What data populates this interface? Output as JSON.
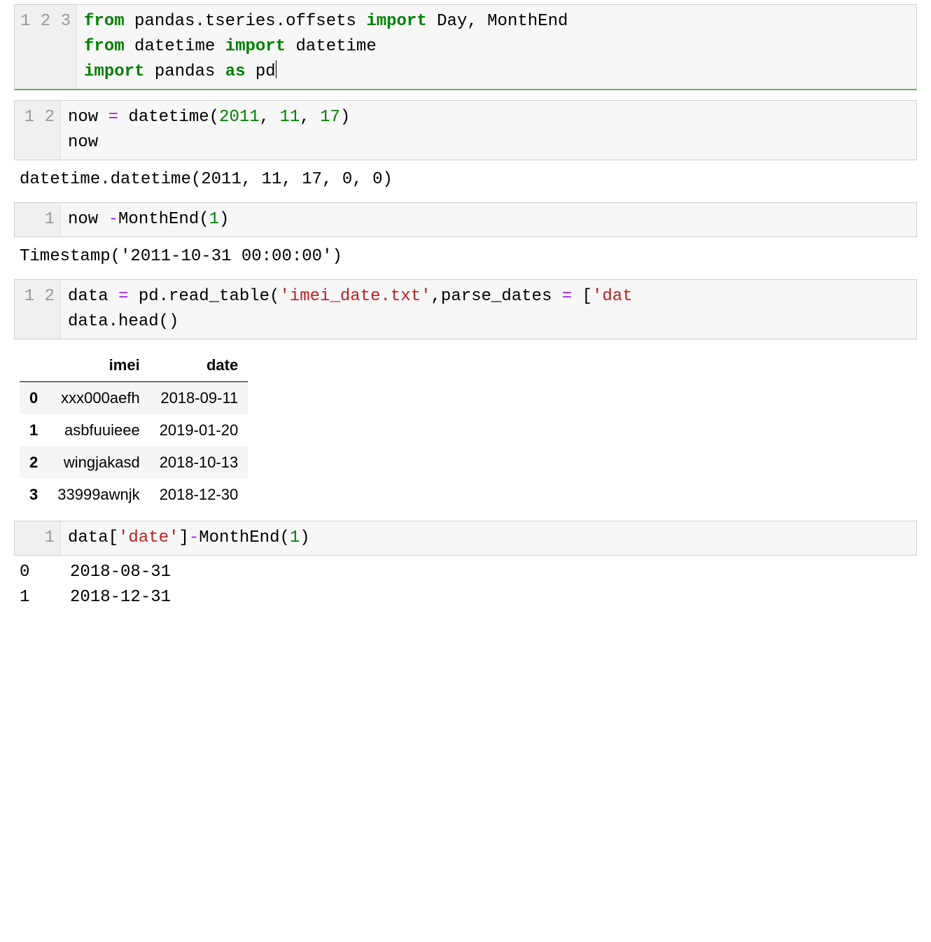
{
  "cells": [
    {
      "lines": [
        "1",
        "2",
        "3"
      ],
      "tokens": [
        [
          [
            "from",
            "kw"
          ],
          [
            " ",
            "id"
          ],
          [
            "pandas.tseries.offsets",
            "id"
          ],
          [
            " ",
            "id"
          ],
          [
            "import",
            "kw"
          ],
          [
            " ",
            "id"
          ],
          [
            "Day, MonthEnd",
            "id"
          ]
        ],
        [
          [
            "from",
            "kw"
          ],
          [
            " ",
            "id"
          ],
          [
            "datetime",
            "id"
          ],
          [
            " ",
            "id"
          ],
          [
            "import",
            "kw"
          ],
          [
            " ",
            "id"
          ],
          [
            "datetime",
            "id"
          ]
        ],
        [
          [
            "import",
            "kw"
          ],
          [
            " ",
            "id"
          ],
          [
            "pandas",
            "id"
          ],
          [
            " ",
            "id"
          ],
          [
            "as",
            "kw"
          ],
          [
            " ",
            "id"
          ],
          [
            "pd",
            "id"
          ]
        ]
      ],
      "ran_ok": true,
      "cursor_end": true
    },
    {
      "lines": [
        "1",
        "2"
      ],
      "tokens": [
        [
          [
            "now ",
            "id"
          ],
          [
            "=",
            "op"
          ],
          [
            " datetime(",
            "id"
          ],
          [
            "2011",
            "num"
          ],
          [
            ", ",
            "id"
          ],
          [
            "11",
            "num"
          ],
          [
            ", ",
            "id"
          ],
          [
            "17",
            "num"
          ],
          [
            ")",
            "id"
          ]
        ],
        [
          [
            "now",
            "id"
          ]
        ]
      ],
      "output": "datetime.datetime(2011, 11, 17, 0, 0)"
    },
    {
      "lines": [
        "1"
      ],
      "tokens": [
        [
          [
            "now ",
            "id"
          ],
          [
            "-",
            "op"
          ],
          [
            "MonthEnd(",
            "id"
          ],
          [
            "1",
            "num"
          ],
          [
            ")",
            "id"
          ]
        ]
      ],
      "output": "Timestamp('2011-10-31 00:00:00')"
    },
    {
      "lines": [
        "1",
        "2"
      ],
      "tokens": [
        [
          [
            "data ",
            "id"
          ],
          [
            "=",
            "op"
          ],
          [
            " pd.read_table(",
            "id"
          ],
          [
            "'imei_date.txt'",
            "str"
          ],
          [
            ",parse_dates ",
            "id"
          ],
          [
            "=",
            "op"
          ],
          [
            " [",
            "id"
          ],
          [
            "'dat",
            "str"
          ]
        ],
        [
          [
            "data.head()",
            "id"
          ]
        ]
      ]
    },
    {
      "lines": [
        "1"
      ],
      "tokens": [
        [
          [
            "data[",
            "id"
          ],
          [
            "'date'",
            "str"
          ],
          [
            "]",
            "id"
          ],
          [
            "-",
            "op"
          ],
          [
            "MonthEnd(",
            "id"
          ],
          [
            "1",
            "num"
          ],
          [
            ")",
            "id"
          ]
        ]
      ]
    }
  ],
  "dataframe": {
    "columns": [
      "imei",
      "date"
    ],
    "index": [
      "0",
      "1",
      "2",
      "3"
    ],
    "rows": [
      [
        "xxx000aefh",
        "2018-09-11"
      ],
      [
        "asbfuuieee",
        "2019-01-20"
      ],
      [
        "wingjakasd",
        "2018-10-13"
      ],
      [
        "33999awnjk",
        "2018-12-30"
      ]
    ]
  },
  "series_out": [
    [
      "0",
      "2018-08-31"
    ],
    [
      "1",
      "2018-12-31"
    ]
  ]
}
